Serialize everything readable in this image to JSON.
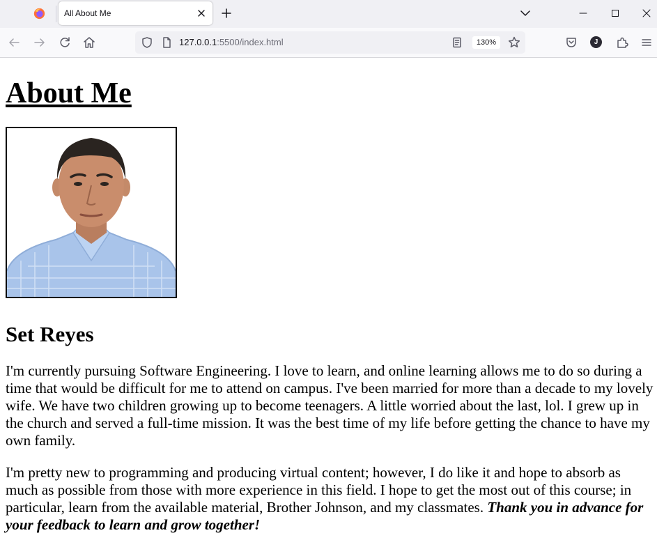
{
  "browser": {
    "tab": {
      "title": "All About Me"
    },
    "url": {
      "host": "127.0.0.1",
      "rest": ":5500/index.html"
    },
    "zoom": "130%",
    "profile_initial": "J"
  },
  "page": {
    "title": "About Me",
    "photo_alt": "Portrait photo",
    "name": "Set Reyes",
    "paragraph1": "I'm currently pursuing Software Engineering. I love to learn, and online learning allows me to do so during a time that would be difficult for me to attend on campus. I've been married for more than a decade to my lovely wife. We have two children growing up to become teenagers. A little worried about the last, lol. I grew up in the church and served a full-time mission. It was the best time of my life before getting the chance to have my own family.",
    "paragraph2": "I'm pretty new to programming and producing virtual content; however, I do like it and hope to absorb as much as possible from those with more experience in this field. I hope to get the most out of this course; in particular, learn from the available material, Brother Johnson, and my classmates. ",
    "paragraph2_emphasis": "Thank you in advance for your feedback to learn and grow together!"
  },
  "colors": {
    "chrome_bg": "#f0f0f4",
    "toolbar_bg": "#f9f9fb",
    "shirt": "#a9c4ea",
    "skin": "#c98d6c"
  },
  "icons": [
    "firefox-logo",
    "close-icon",
    "plus-icon",
    "chevron-down-icon",
    "minimize-icon",
    "maximize-icon",
    "back-arrow-icon",
    "forward-arrow-icon",
    "reload-icon",
    "home-icon",
    "shield-icon",
    "page-icon",
    "reader-view-icon",
    "star-icon",
    "pocket-icon",
    "extensions-icon",
    "menu-icon"
  ]
}
